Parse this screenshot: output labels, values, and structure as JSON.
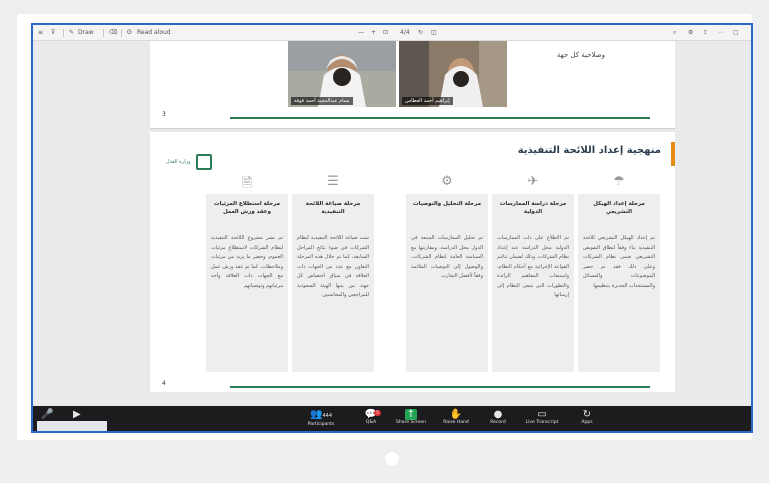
{
  "toolbar": {
    "items": [
      "Draw",
      "Read aloud"
    ],
    "right_icons": [
      "search-icon",
      "settings-icon",
      "share-icon",
      "more-icon"
    ]
  },
  "slide_top": {
    "text": "وصلاحية كل جهة",
    "page_number": "3"
  },
  "videos": [
    {
      "name": "بسام عبدالمجيد أحمد فوفة"
    },
    {
      "name": "إبراهيم أحمد العطاس"
    }
  ],
  "slide_main": {
    "title": "منهجية إعداد اللائحة التنفيذية",
    "logo_text": "وزارة العدل",
    "page_number": "4",
    "columns": [
      {
        "icon": "☂",
        "heading": "مرحلة إعداد الهيكل التشريعي",
        "body": "تم إعداد الهيكل التشريعي للائحة التنفيذية بناء وفقاً لنطاق التفويض التشريعي ضمن نظام الشركات وعلى ذلك فقد تم حصر الموضوعات والمسائل والمستجدات الجديرة بتنظيمها"
      },
      {
        "icon": "✈",
        "heading": "مرحلة دراسة الممارسات الدولية",
        "body": "تم الاطلاع على ذات الممارسات الدولية محل الدراسة عند إعداد نظام الشركات، وذلك لضمان تناغم القواعد الإجرائية مع أحكام النظام، واستيعاب المفاهيم الرائدة والتطورات التي سعى النظام إلى إرسائها"
      },
      {
        "icon": "⚙",
        "heading": "مرحلة التحليل والتوصيات",
        "body": "تم تحليل الممارسات المتبعة في الدول محل الدراسة، ومقارنتها مع السياسة العامة لنظام الشركات، والوصول إلى التوصيات الملائمة وفقاً لأفضل التجارب"
      },
      {
        "icon": "☰",
        "heading": "مرحلة صياغة اللائحة التنفيذية",
        "body": "تمت صياغة اللائحة التنفيذية لنظام الشركات في ضوء نتائج المراحل السابقة، كما تم خلال هذه المرحلة التعاون مع عدد من الجهات ذات العلاقة في سياق اختصاص كل جهة، من بينها الهيئة السعودية للمراجعين والمحاسبين"
      },
      {
        "icon": "🗎",
        "heading": "مرحلة استطلاع المرئيات وعقد ورش العمل",
        "body": "تم نشر مشروع اللائحة التنفيذية لنظام الشركات لاستطلاع مرئيات العموم، وحضر ما يزيد من مرئيات وملاحظات، كما تم عقد ورش عمل مع الجهات ذات العلاقة وأخذ مرئياتهم وتوصياتهم"
      }
    ]
  },
  "zoom": {
    "buttons": [
      {
        "label": "Participants",
        "count": "444",
        "icon": "participants-icon"
      },
      {
        "label": "Q&A",
        "badge": "5",
        "icon": "qa-icon"
      },
      {
        "label": "Share Screen",
        "icon": "share-screen-icon"
      },
      {
        "label": "Raise Hand",
        "icon": "raise-hand-icon"
      },
      {
        "label": "Record",
        "icon": "record-icon"
      },
      {
        "label": "Live Transcript",
        "icon": "live-transcript-icon"
      },
      {
        "label": "Apps",
        "icon": "apps-icon"
      }
    ]
  }
}
